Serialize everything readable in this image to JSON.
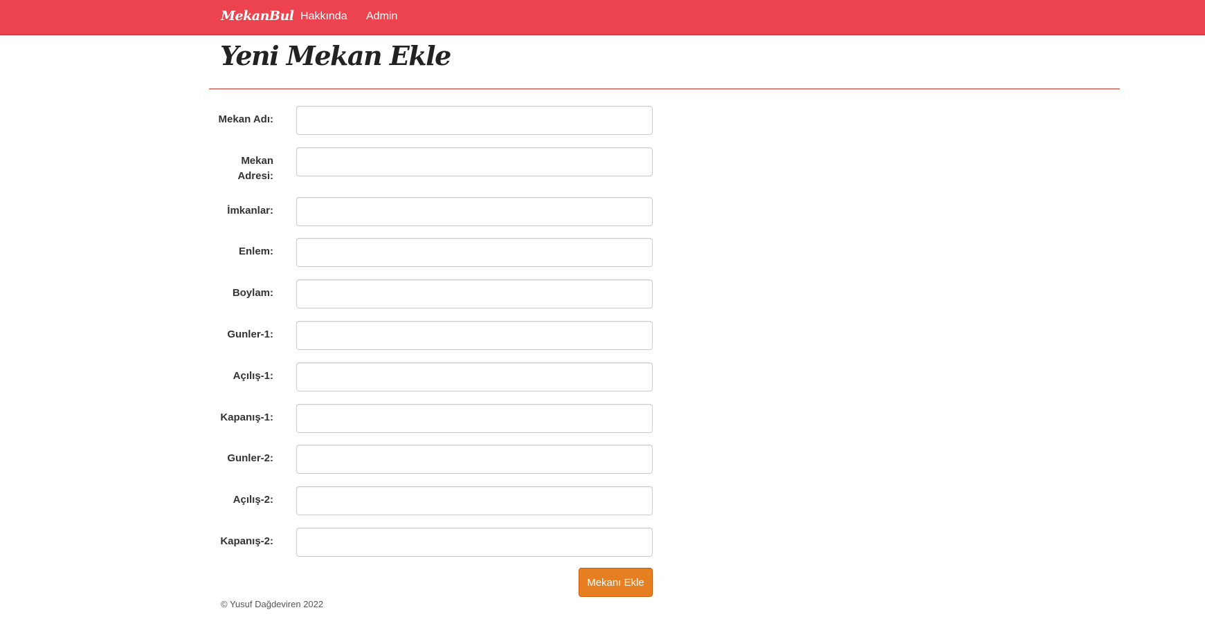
{
  "nav": {
    "brand": "MekanBul",
    "links": [
      "Hakkında",
      "Admin"
    ]
  },
  "page": {
    "title": "Yeni Mekan Ekle"
  },
  "form": {
    "fields": [
      {
        "label": "Mekan Adı:",
        "value": ""
      },
      {
        "label": "Mekan Adresi:",
        "value": ""
      },
      {
        "label": "İmkanlar:",
        "value": ""
      },
      {
        "label": "Enlem:",
        "value": ""
      },
      {
        "label": "Boylam:",
        "value": ""
      },
      {
        "label": "Gunler-1:",
        "value": ""
      },
      {
        "label": "Açılış-1:",
        "value": ""
      },
      {
        "label": "Kapanış-1:",
        "value": ""
      },
      {
        "label": "Gunler-2:",
        "value": ""
      },
      {
        "label": "Açılış-2:",
        "value": ""
      },
      {
        "label": "Kapanış-2:",
        "value": ""
      }
    ],
    "submit_label": "Mekanı Ekle"
  },
  "footer": {
    "text": "© Yusuf Dağdeviren 2022"
  },
  "colors": {
    "navbar": "#ec434e",
    "button": "#e67e22",
    "divider": "#c9302c"
  }
}
